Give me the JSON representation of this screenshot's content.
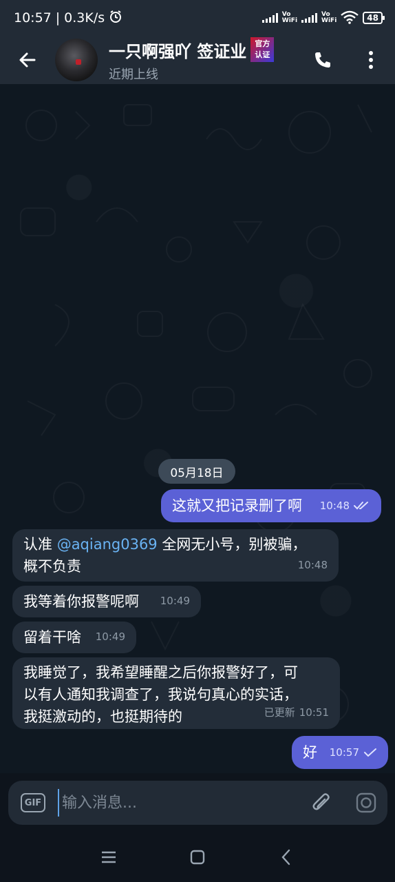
{
  "status_bar": {
    "time": "10:57",
    "speed": "0.3K/s",
    "vowifi_1_top": "Vo",
    "vowifi_1_bottom": "WiFi",
    "vowifi_2_top": "Vo",
    "vowifi_2_bottom": "WiFi",
    "battery": "48"
  },
  "header": {
    "title": "一只啊强吖 签证业",
    "badge_line1": "官方",
    "badge_line2": "认证",
    "subtitle": "近期上线"
  },
  "chat": {
    "date": "05月18日",
    "messages": [
      {
        "direction": "out",
        "text": "这就又把记录删了啊",
        "time": "10:48",
        "status": "read"
      },
      {
        "direction": "in",
        "prefix": "认准 ",
        "mention": "@aqiang0369",
        "suffix": " 全网无小号，别被骗，",
        "line2": "概不负责",
        "time": "10:48"
      },
      {
        "direction": "in",
        "text": "我等着你报警呢啊",
        "time": "10:49"
      },
      {
        "direction": "in",
        "text": "留着干啥",
        "time": "10:49"
      },
      {
        "direction": "in",
        "line1": "我睡觉了，我希望睡醒之后你报警好了，可",
        "line2": "以有人通知我调查了，我说句真心的实话，",
        "line3": "我挺激动的，也挺期待的",
        "edited": "已更新",
        "time": "10:51"
      },
      {
        "direction": "out",
        "text": "好",
        "time": "10:57",
        "status": "sent"
      }
    ]
  },
  "input": {
    "gif_label": "GIF",
    "placeholder": "输入消息..."
  },
  "colors": {
    "outgoing_bubble": "#5b61d6",
    "incoming_bubble": "#232d39",
    "header_bg": "#222b36",
    "link": "#6ab3f3"
  }
}
